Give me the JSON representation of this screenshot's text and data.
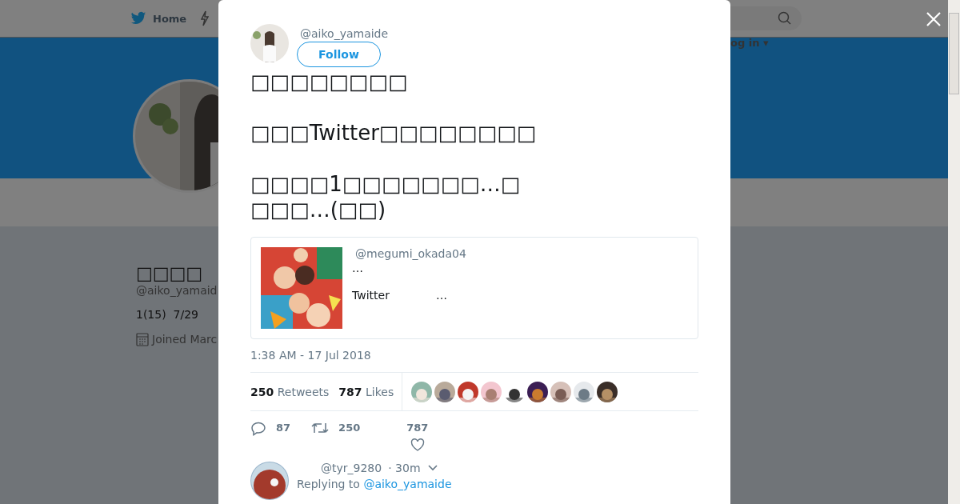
{
  "background_page": {
    "nav": [
      {
        "label": "Home",
        "kind": "home"
      },
      {
        "kind": "moments"
      }
    ],
    "login": "og in ▾",
    "profile": {
      "name": "□□□□",
      "handle": "@aiko_yamaid",
      "bio": "1(15)  7/29",
      "joined": "Joined Marc"
    }
  },
  "tweet": {
    "handle": "@aiko_yamaide",
    "follow": "Follow",
    "paragraphs": [
      [
        "□□□□□□□□"
      ],
      [
        "□□□Twitter□□□□□□□□"
      ],
      [
        "□□□□1□□□□□□□…□",
        "□□□…(□□)"
      ]
    ],
    "quoted": {
      "handle": "@megumi_okada04",
      "line_1": "…",
      "line_2_a": "Twitter",
      "line_2_b": "…"
    },
    "timestamp": "1:38 AM - 17 Jul 2018",
    "retweet_count": "250",
    "retweet_label": "Retweets",
    "like_count": "787",
    "like_label": "Likes",
    "likers": [
      {
        "kind": "picture"
      },
      {
        "kind": "picture"
      },
      {
        "kind": "picture"
      },
      {
        "kind": "picture"
      },
      {
        "kind": "picture"
      },
      {
        "kind": "picture"
      },
      {
        "kind": "picture"
      },
      {
        "kind": "picture"
      },
      {
        "kind": "picture"
      }
    ],
    "actions": {
      "replies": "87",
      "retweets": "250",
      "likes": "787"
    }
  },
  "reply": {
    "handle": "@tyr_9280",
    "time": "· 30m",
    "replying_label": "Replying to",
    "replying_to": "@aiko_yamaide"
  }
}
